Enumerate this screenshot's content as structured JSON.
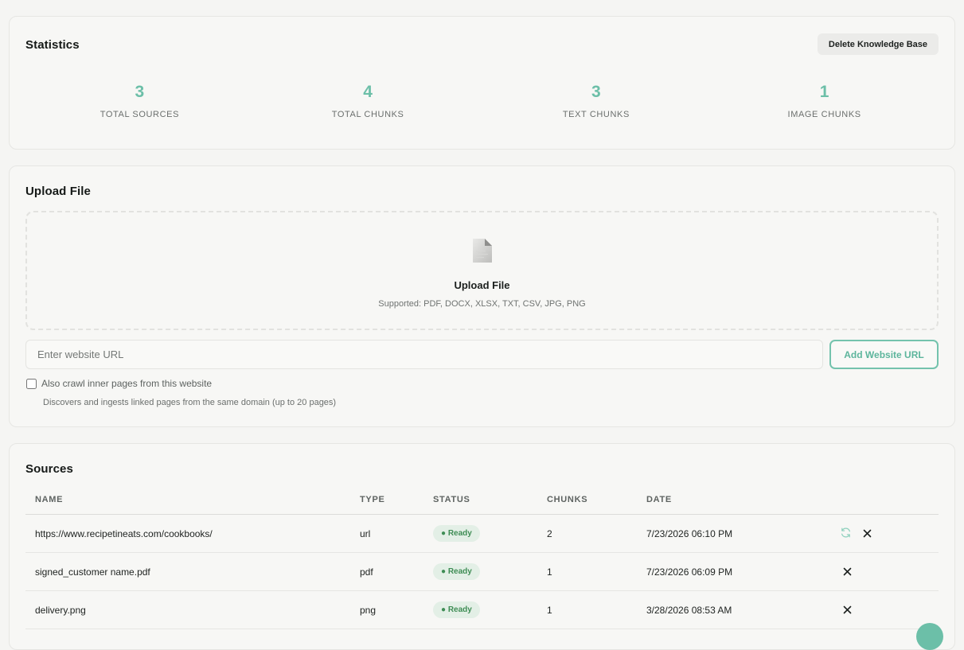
{
  "stats": {
    "title": "Statistics",
    "delete_label": "Delete Knowledge Base",
    "items": [
      {
        "value": "3",
        "label": "TOTAL SOURCES"
      },
      {
        "value": "4",
        "label": "TOTAL CHUNKS"
      },
      {
        "value": "3",
        "label": "TEXT CHUNKS"
      },
      {
        "value": "1",
        "label": "IMAGE CHUNKS"
      }
    ]
  },
  "upload": {
    "title": "Upload File",
    "dropzone_title": "Upload File",
    "dropzone_sub": "Supported: PDF, DOCX, XLSX, TXT, CSV, JPG, PNG",
    "url_placeholder": "Enter website URL",
    "add_url_label": "Add Website URL",
    "crawl_label": "Also crawl inner pages from this website",
    "crawl_help": "Discovers and ingests linked pages from the same domain (up to 20 pages)"
  },
  "sources": {
    "title": "Sources",
    "columns": [
      "NAME",
      "TYPE",
      "STATUS",
      "CHUNKS",
      "DATE"
    ],
    "rows": [
      {
        "name": "https://www.recipetineats.com/cookbooks/",
        "type": "url",
        "status": "● Ready",
        "chunks": "2",
        "date": "7/23/2026 06:10 PM"
      },
      {
        "name": "signed_customer name.pdf",
        "type": "pdf",
        "status": "● Ready",
        "chunks": "1",
        "date": "7/23/2026 06:09 PM"
      },
      {
        "name": "delivery.png",
        "type": "png",
        "status": "● Ready",
        "chunks": "1",
        "date": "3/28/2026 08:53 AM"
      }
    ]
  },
  "colors": {
    "accent": "#6cbfa8",
    "ready_bg": "#e3efe6",
    "ready_text": "#3f8d55"
  }
}
